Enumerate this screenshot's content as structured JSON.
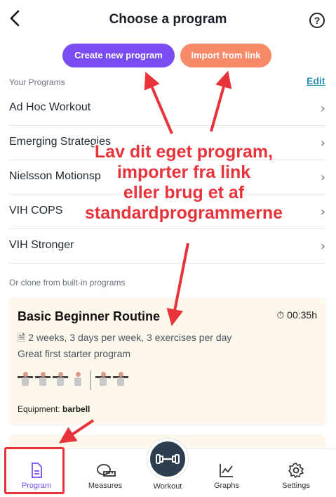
{
  "header": {
    "title": "Choose a program",
    "back_icon": "chevron-left-icon",
    "help_label": "?"
  },
  "actions": {
    "create_label": "Create new program",
    "import_label": "Import from link",
    "create_color": "#7a4df2",
    "import_color": "#f88a6a"
  },
  "your_programs": {
    "label": "Your Programs",
    "edit_label": "Edit",
    "items": [
      {
        "name": "Ad Hoc Workout"
      },
      {
        "name": "Emerging Strategies"
      },
      {
        "name": "Nielsson Motionsp"
      },
      {
        "name": "VIH COPS"
      },
      {
        "name": "VIH Stronger"
      }
    ]
  },
  "builtin": {
    "label": "Or clone from built-in programs",
    "card": {
      "title": "Basic Beginner Routine",
      "duration": "00:35h",
      "meta": "2 weeks, 3 days per week, 3 exercises per day",
      "description": "Great first starter program",
      "equipment_label": "Equipment:",
      "equipment_value": "barbell"
    }
  },
  "tabs": [
    {
      "label": "Program",
      "icon": "document-icon",
      "active": true
    },
    {
      "label": "Measures",
      "icon": "measuring-tape-icon"
    },
    {
      "label": "Workout",
      "icon": "dumbbell-icon"
    },
    {
      "label": "Graphs",
      "icon": "line-chart-icon"
    },
    {
      "label": "Settings",
      "icon": "gear-icon"
    }
  ],
  "annotation": {
    "lines": [
      "Lav dit eget program,",
      "importer fra link",
      "eller brug et af",
      "standardprogrammerne"
    ],
    "color": "#e8333b"
  }
}
